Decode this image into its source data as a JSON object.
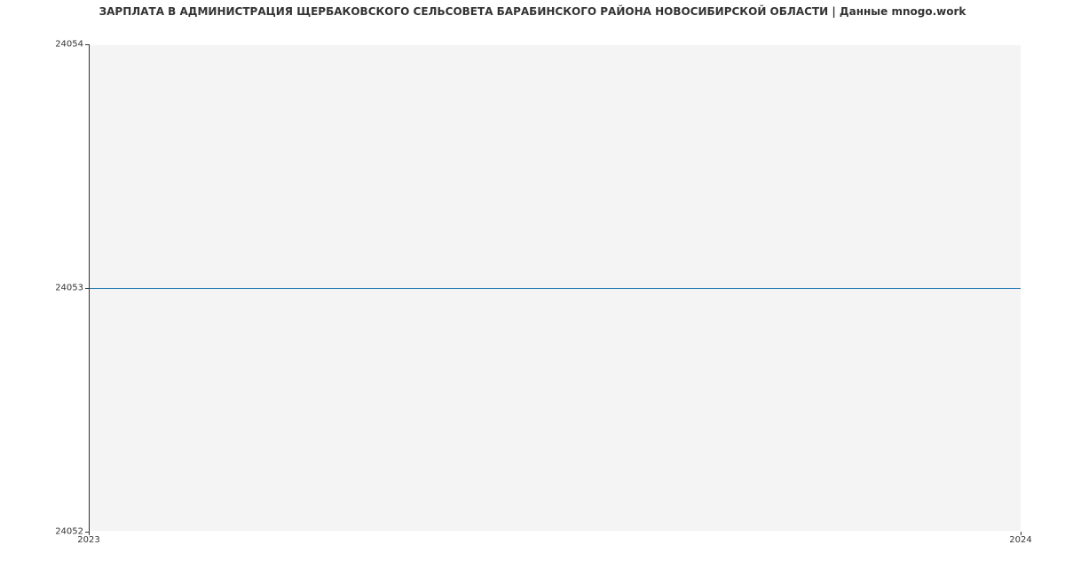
{
  "chart_data": {
    "type": "line",
    "title": "ЗАРПЛАТА В АДМИНИСТРАЦИЯ ЩЕРБАКОВСКОГО СЕЛЬСОВЕТА БАРАБИНСКОГО РАЙОНА НОВОСИБИРСКОЙ ОБЛАСТИ | Данные mnogo.work",
    "x": [
      2023,
      2024
    ],
    "values": [
      24053,
      24053
    ],
    "xlabel": "",
    "ylabel": "",
    "y_ticks": [
      24052,
      24053,
      24054
    ],
    "x_ticks": [
      2023,
      2024
    ],
    "ylim": [
      24052,
      24054
    ],
    "xlim": [
      2023,
      2024
    ],
    "line_color": "#1f77b4",
    "grid": true
  },
  "labels": {
    "y0": "24052",
    "y1": "24053",
    "y2": "24054",
    "x0": "2023",
    "x1": "2024"
  }
}
